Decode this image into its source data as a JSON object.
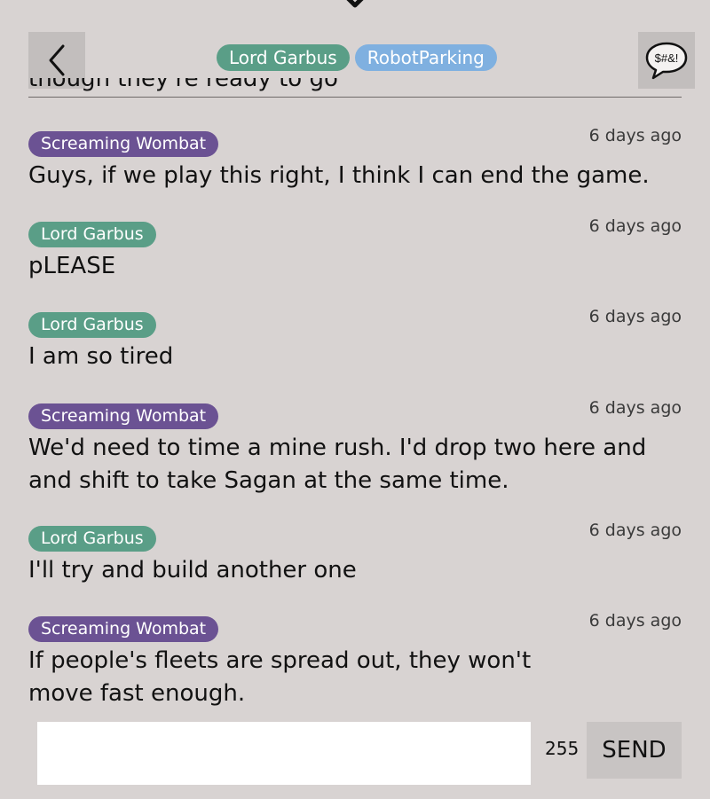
{
  "header": {
    "participants": [
      {
        "name": "Lord Garbus",
        "color": "#5a9e87"
      },
      {
        "name": "RobotParking",
        "color": "#7fb0e0"
      }
    ],
    "swear_label": "$#&!"
  },
  "cutoff_previous_message": "though they're ready to go",
  "messages": [
    {
      "author": "Screaming Wombat",
      "color": "#6b5293",
      "time": "6 days ago",
      "text": "Guys, if we play this right, I think I can end the game."
    },
    {
      "author": "Lord Garbus",
      "color": "#5a9e87",
      "time": "6 days ago",
      "text": "pLEASE"
    },
    {
      "author": "Lord Garbus",
      "color": "#5a9e87",
      "time": "6 days ago",
      "text": "I am so tired"
    },
    {
      "author": "Screaming Wombat",
      "color": "#6b5293",
      "time": "6 days ago",
      "text": "We'd need to time a mine rush. I'd drop two here and and shift to take Sagan at the same time."
    },
    {
      "author": "Lord Garbus",
      "color": "#5a9e87",
      "time": "6 days ago",
      "text": "I'll try and build another one"
    },
    {
      "author": "Screaming Wombat",
      "color": "#6b5293",
      "time": "6 days ago",
      "text": "If people's fleets are spread out, they won't move fast enough."
    }
  ],
  "composer": {
    "value": "",
    "char_count": "255",
    "send_label": "SEND"
  }
}
